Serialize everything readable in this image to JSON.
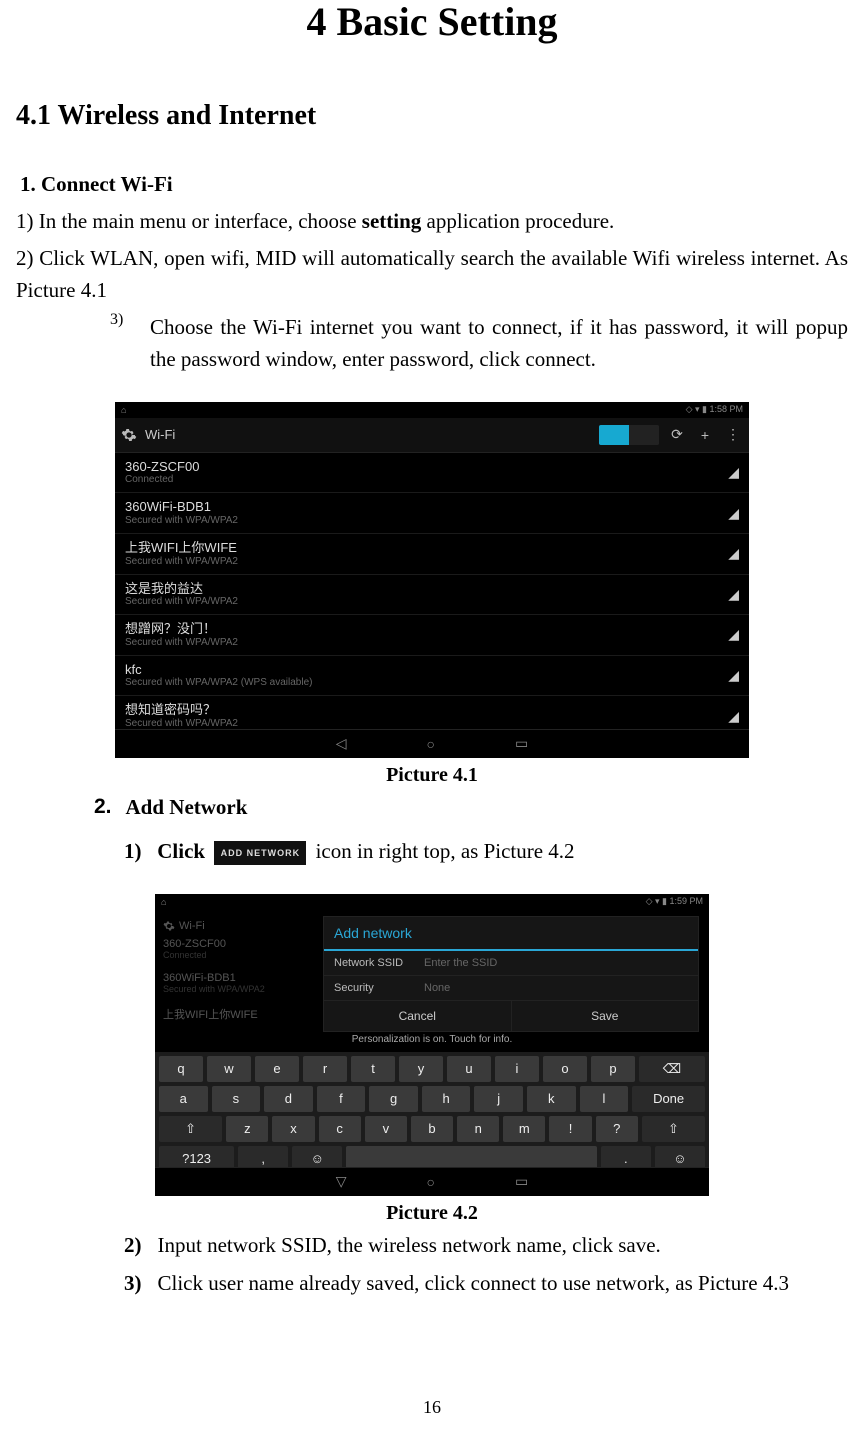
{
  "heading": "4 Basic Setting",
  "section": "4.1 Wireless and Internet",
  "subsection": "1. Connect Wi-Fi",
  "steps": {
    "s1_pre": "1) In the main menu or interface, choose ",
    "s1_bold": "setting",
    "s1_post": " application procedure.",
    "s2": "2) Click WLAN, open wifi, MID will automatically search the available Wifi wireless internet. As Picture 4.1",
    "s3_marker": "3)",
    "s3": "Choose the Wi-Fi internet you want to connect, if it has password, it will popup the password window, enter password, click connect."
  },
  "caption1": "Picture 4.1",
  "item2_marker": "2.",
  "item2_label": "Add Network",
  "sub1_marker": "1)",
  "sub1_pre": "Click ",
  "addnet_icon_label": "ADD NETWORK",
  "sub1_post": " icon in right top, as Picture 4.2",
  "caption2": "Picture 4.2",
  "sub2_marker": "2)",
  "sub2": "Input network SSID, the wireless network name, click save.",
  "sub3_marker": "3)",
  "sub3": "Click user name already saved, click connect to use network, as Picture 4.3",
  "page_number": "16",
  "shot1": {
    "status_left": "⌂",
    "status_right": "◇ ▾ ▮ 1:58 PM",
    "title": "Wi-Fi",
    "refresh_icon": "⟳",
    "add_icon": "+",
    "menu_icon": "⋮",
    "networks": [
      {
        "name": "360-ZSCF00",
        "sub": "Connected"
      },
      {
        "name": "360WiFi-BDB1",
        "sub": "Secured with WPA/WPA2"
      },
      {
        "name": "上我WIFI上你WIFE",
        "sub": "Secured with WPA/WPA2"
      },
      {
        "name": "这是我的益达",
        "sub": "Secured with WPA/WPA2"
      },
      {
        "name": "想蹭网？没门！",
        "sub": "Secured with WPA/WPA2"
      },
      {
        "name": "kfc",
        "sub": "Secured with WPA/WPA2 (WPS available)"
      },
      {
        "name": "想知道密码吗？",
        "sub": "Secured with WPA/WPA2"
      }
    ],
    "nav": {
      "back": "◁",
      "home": "○",
      "recent": "▭"
    }
  },
  "shot2": {
    "status_left": "⌂",
    "status_right": "◇ ▾ ▮ 1:59 PM",
    "title": "Wi-Fi",
    "dim_rows": [
      {
        "n": "360-ZSCF00",
        "s": "Connected"
      },
      {
        "n": "360WiFi-BDB1",
        "s": "Secured with WPA/WPA2"
      },
      {
        "n": "上我WIFI上你WIFE",
        "s": ""
      }
    ],
    "dialog": {
      "title": "Add network",
      "ssid_label": "Network SSID",
      "ssid_placeholder": "Enter the SSID",
      "sec_label": "Security",
      "sec_value": "None",
      "cancel": "Cancel",
      "save": "Save"
    },
    "toast": "Personalization is on. Touch for info.",
    "kbd": {
      "r1": [
        "q",
        "w",
        "e",
        "r",
        "t",
        "y",
        "u",
        "i",
        "o",
        "p"
      ],
      "bksp": "⌫",
      "r2": [
        "a",
        "s",
        "d",
        "f",
        "g",
        "h",
        "j",
        "k",
        "l"
      ],
      "done": "Done",
      "shift": "⇧",
      "r3": [
        "z",
        "x",
        "c",
        "v",
        "b",
        "n",
        "m",
        "!",
        "?"
      ],
      "shift2": "⇧",
      "sym": "?123",
      "emoji": "☺",
      "space": "",
      "period": ".",
      "comma": ","
    },
    "nav": {
      "back": "▽",
      "home": "○",
      "recent": "▭"
    }
  }
}
